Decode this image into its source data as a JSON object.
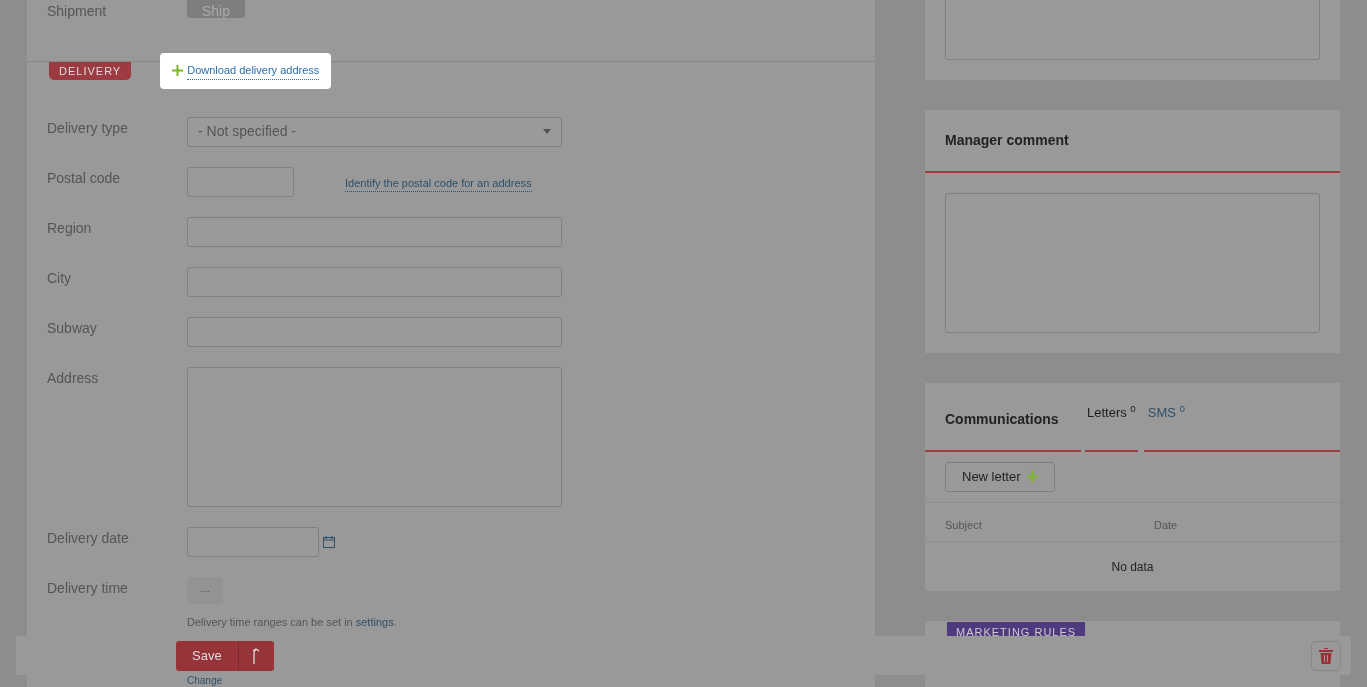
{
  "shipment": {
    "label": "Shipment",
    "button": "Ship"
  },
  "delivery": {
    "badge": "DELIVERY",
    "download_link": "Download delivery address",
    "highlighted": true,
    "fields": [
      {
        "label": "Delivery type",
        "kind": "select",
        "value": "- Not specified -"
      },
      {
        "label": "Postal code",
        "kind": "short",
        "link": "Identify the postal code for an address"
      },
      {
        "label": "Region",
        "kind": "text"
      },
      {
        "label": "City",
        "kind": "text"
      },
      {
        "label": "Subway",
        "kind": "text"
      },
      {
        "label": "Address",
        "kind": "textarea"
      },
      {
        "label": "Delivery date",
        "kind": "date"
      },
      {
        "label": "Delivery time",
        "kind": "time",
        "button": "....",
        "hint": "Delivery time ranges can be set in ",
        "hint_link": "settings",
        "hint_end": "."
      }
    ],
    "change_link": "Change"
  },
  "manager_comment": {
    "title": "Manager comment"
  },
  "communications": {
    "title": "Communications",
    "tabs": [
      {
        "label": "Letters",
        "count": "0",
        "selected": true
      },
      {
        "label": "SMS",
        "count": "0",
        "selected": false
      }
    ],
    "new_button": "New letter",
    "columns": [
      "Subject",
      "Date"
    ],
    "empty": "No data"
  },
  "marketing": {
    "badge": "MARKETING RULES"
  },
  "footer": {
    "save": "Save"
  }
}
